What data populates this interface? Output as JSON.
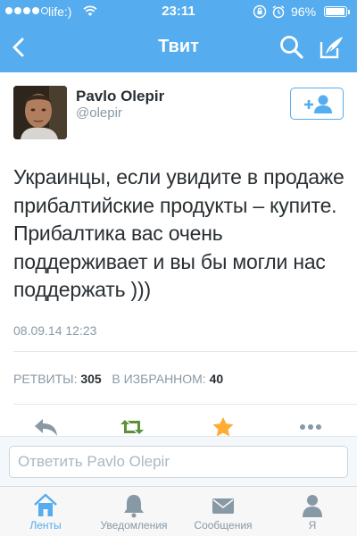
{
  "status_bar": {
    "carrier": "life:)",
    "time": "23:11",
    "battery_percent": "96%",
    "battery_level": 0.96,
    "signal_bars_filled": 4,
    "signal_bars_total": 5
  },
  "nav": {
    "title": "Твит",
    "back_icon": "chevron-left-icon",
    "search_icon": "search-icon",
    "compose_icon": "compose-icon",
    "color": "#55acee"
  },
  "tweet": {
    "author_name": "Pavlo Olepir",
    "author_handle": "@olepir",
    "text": "Украинцы, если увидите в продаже прибалтийские продукты – купите. Прибалтика вас очень поддерживает и вы бы могли нас поддержать )))",
    "timestamp": "08.09.14 12:23",
    "follow_icon": "add-user-icon"
  },
  "stats": {
    "retweets_label": "РЕТВИТЫ:",
    "retweets_count": "305",
    "favorites_label": "В ИЗБРАННОМ:",
    "favorites_count": "40"
  },
  "actions": {
    "reply_icon": "reply-icon",
    "retweet_icon": "retweet-icon",
    "retweet_color": "#5c913b",
    "favorite_icon": "star-icon",
    "favorite_color": "#ffac33",
    "more_icon": "more-icon"
  },
  "reply": {
    "placeholder": "Ответить Pavlo Olepir"
  },
  "tabs": [
    {
      "label": "Ленты",
      "icon": "home-icon",
      "active": true
    },
    {
      "label": "Уведомления",
      "icon": "bell-icon",
      "active": false
    },
    {
      "label": "Сообщения",
      "icon": "envelope-icon",
      "active": false
    },
    {
      "label": "Я",
      "icon": "person-icon",
      "active": false
    }
  ]
}
